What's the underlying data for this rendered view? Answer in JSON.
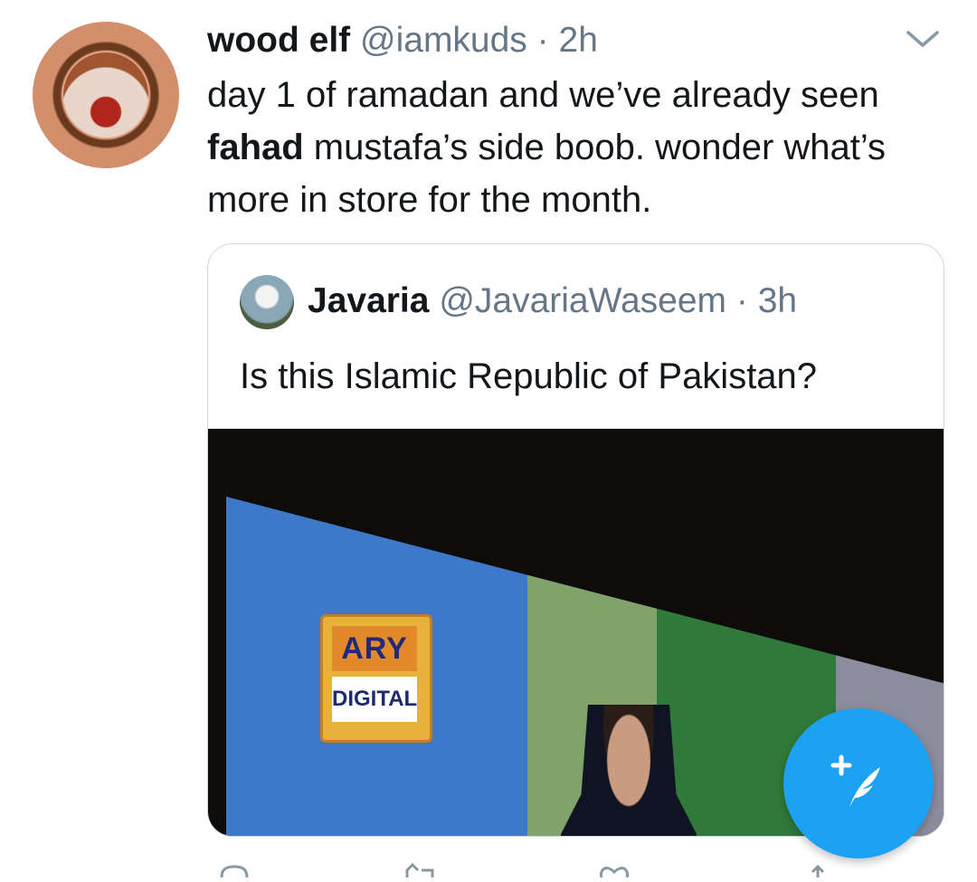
{
  "tweet": {
    "author_name": "wood elf",
    "handle": "@iamkuds",
    "separator": "·",
    "time": "2h",
    "text_line1": "day 1 of ramadan and we’ve already seen",
    "text_bold": "fahad",
    "text_rest": " mustafa’s side boob. wonder what’s more in store for the month."
  },
  "quoted_tweet": {
    "author_name": "Javaria",
    "handle": "@JavariaWaseem",
    "separator": "·",
    "time": "3h",
    "text": "Is this Islamic Republic of Pakistan?",
    "media": {
      "logo_top": "ARY",
      "logo_bottom": "DIGITAL"
    }
  },
  "icons": {
    "caret": "chevron-down-icon",
    "compose": "compose-tweet-icon",
    "reply": "reply-icon",
    "retweet": "retweet-icon",
    "like": "heart-icon",
    "share": "share-icon"
  },
  "colors": {
    "accent": "#1da1f2",
    "secondary_text": "#657786",
    "border": "#ccd6dd"
  }
}
